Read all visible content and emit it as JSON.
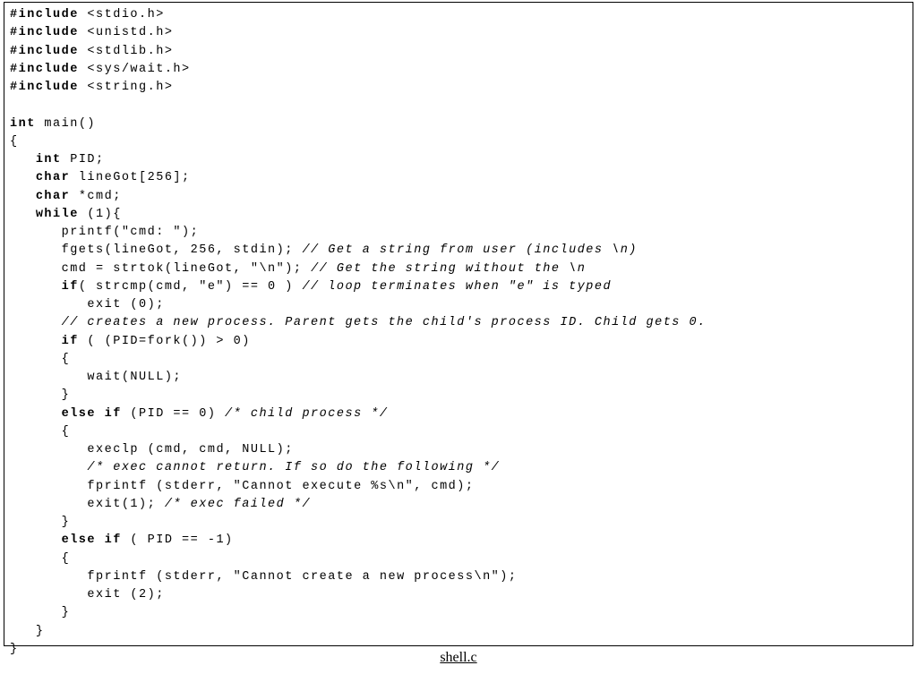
{
  "code": {
    "lines": [
      {
        "indent": 0,
        "segments": [
          {
            "t": "#include",
            "b": true
          },
          {
            "t": " <stdio.h>"
          }
        ]
      },
      {
        "indent": 0,
        "segments": [
          {
            "t": "#include",
            "b": true
          },
          {
            "t": " <unistd.h>"
          }
        ]
      },
      {
        "indent": 0,
        "segments": [
          {
            "t": "#include",
            "b": true
          },
          {
            "t": " <stdlib.h>"
          }
        ]
      },
      {
        "indent": 0,
        "segments": [
          {
            "t": "#include",
            "b": true
          },
          {
            "t": " <sys/wait.h>"
          }
        ]
      },
      {
        "indent": 0,
        "segments": [
          {
            "t": "#include",
            "b": true
          },
          {
            "t": " <string.h>"
          }
        ]
      },
      {
        "indent": 0,
        "segments": [
          {
            "t": " "
          }
        ]
      },
      {
        "indent": 0,
        "segments": [
          {
            "t": "int",
            "b": true
          },
          {
            "t": " main()"
          }
        ]
      },
      {
        "indent": 0,
        "segments": [
          {
            "t": "{"
          }
        ]
      },
      {
        "indent": 1,
        "segments": [
          {
            "t": "int",
            "b": true
          },
          {
            "t": " PID;"
          }
        ]
      },
      {
        "indent": 1,
        "segments": [
          {
            "t": "char",
            "b": true
          },
          {
            "t": " lineGot[256];"
          }
        ]
      },
      {
        "indent": 1,
        "segments": [
          {
            "t": "char",
            "b": true
          },
          {
            "t": " *cmd;"
          }
        ]
      },
      {
        "indent": 1,
        "segments": [
          {
            "t": "while",
            "b": true
          },
          {
            "t": " (1){"
          }
        ]
      },
      {
        "indent": 2,
        "segments": [
          {
            "t": "printf(\"cmd: \");"
          }
        ]
      },
      {
        "indent": 2,
        "segments": [
          {
            "t": "fgets(lineGot, 256, stdin); "
          },
          {
            "t": "// Get a string from user (includes \\n)",
            "i": true
          }
        ]
      },
      {
        "indent": 2,
        "segments": [
          {
            "t": "cmd = strtok(lineGot, \"\\n\"); "
          },
          {
            "t": "// Get the string without the \\n",
            "i": true
          }
        ]
      },
      {
        "indent": 2,
        "segments": [
          {
            "t": "if",
            "b": true
          },
          {
            "t": "( strcmp(cmd, \"e\") == 0 ) "
          },
          {
            "t": "// loop terminates when \"e\" is typed",
            "i": true
          }
        ]
      },
      {
        "indent": 3,
        "segments": [
          {
            "t": "exit (0);"
          }
        ]
      },
      {
        "indent": 2,
        "segments": [
          {
            "t": "// creates a new process. Parent gets the child's process ID. Child gets 0.",
            "i": true
          }
        ]
      },
      {
        "indent": 2,
        "segments": [
          {
            "t": "if",
            "b": true
          },
          {
            "t": " ( (PID=fork()) > 0)"
          }
        ]
      },
      {
        "indent": 2,
        "segments": [
          {
            "t": "{"
          }
        ]
      },
      {
        "indent": 3,
        "segments": [
          {
            "t": "wait(NULL);"
          }
        ]
      },
      {
        "indent": 2,
        "segments": [
          {
            "t": "}"
          }
        ]
      },
      {
        "indent": 2,
        "segments": [
          {
            "t": "else if",
            "b": true
          },
          {
            "t": " (PID == 0) "
          },
          {
            "t": "/* child process */",
            "i": true
          }
        ]
      },
      {
        "indent": 2,
        "segments": [
          {
            "t": "{"
          }
        ]
      },
      {
        "indent": 3,
        "segments": [
          {
            "t": "execlp (cmd, cmd, NULL);"
          }
        ]
      },
      {
        "indent": 3,
        "segments": [
          {
            "t": "/* exec cannot return. If so do the following */",
            "i": true
          }
        ]
      },
      {
        "indent": 3,
        "segments": [
          {
            "t": "fprintf (stderr, \"Cannot execute %s\\n\", cmd);"
          }
        ]
      },
      {
        "indent": 3,
        "segments": [
          {
            "t": "exit(1); "
          },
          {
            "t": "/* exec failed */",
            "i": true
          }
        ]
      },
      {
        "indent": 2,
        "segments": [
          {
            "t": "}"
          }
        ]
      },
      {
        "indent": 2,
        "segments": [
          {
            "t": "else if",
            "b": true
          },
          {
            "t": " ( PID == -1)"
          }
        ]
      },
      {
        "indent": 2,
        "segments": [
          {
            "t": "{"
          }
        ]
      },
      {
        "indent": 3,
        "segments": [
          {
            "t": "fprintf (stderr, \"Cannot create a new process\\n\");"
          }
        ]
      },
      {
        "indent": 3,
        "segments": [
          {
            "t": "exit (2);"
          }
        ]
      },
      {
        "indent": 2,
        "segments": [
          {
            "t": "}"
          }
        ]
      },
      {
        "indent": 1,
        "segments": [
          {
            "t": "}"
          }
        ]
      },
      {
        "indent": 0,
        "segments": [
          {
            "t": "}"
          }
        ]
      }
    ]
  },
  "caption": "shell.c",
  "indentUnit": "   "
}
